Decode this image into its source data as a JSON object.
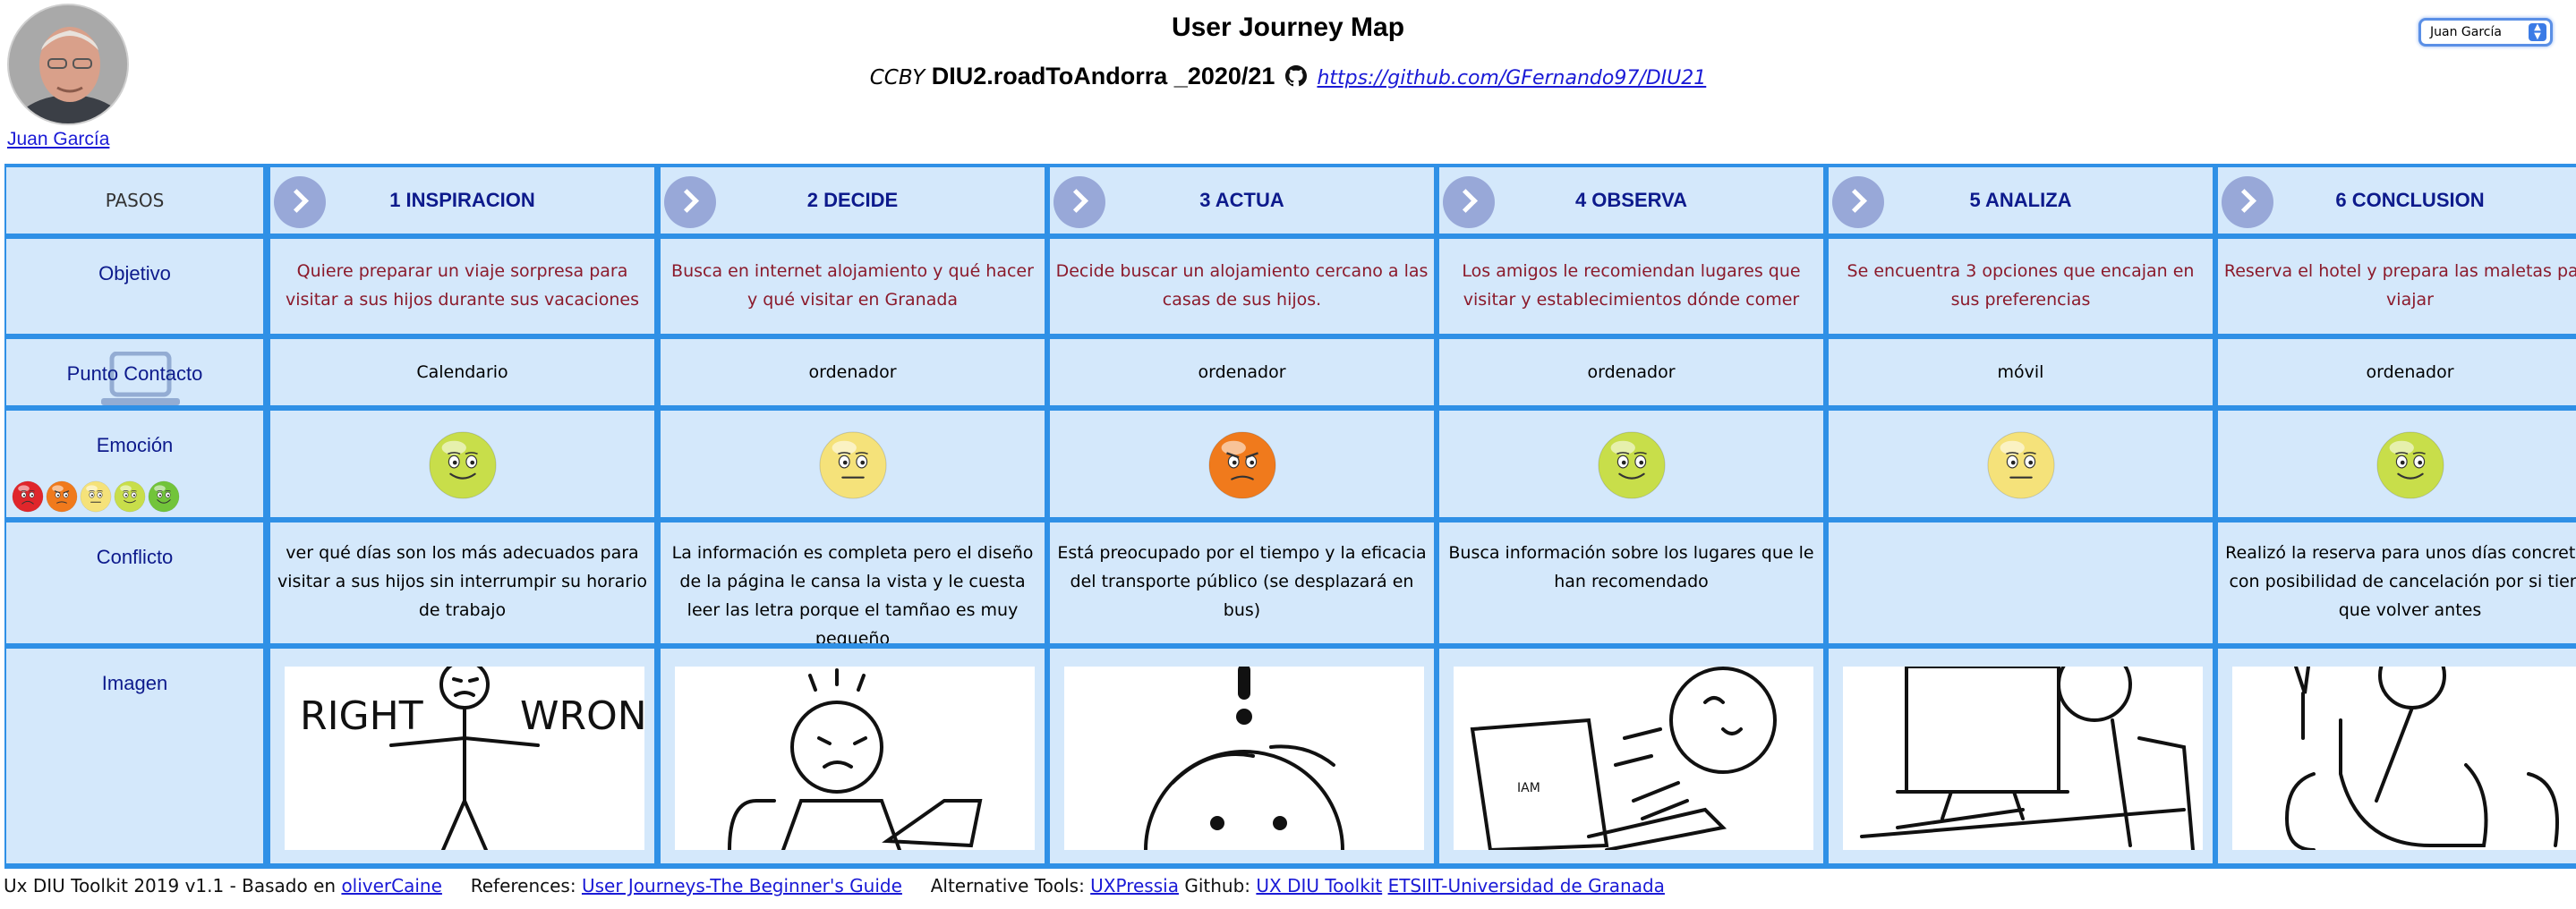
{
  "user": {
    "name": "Juan García"
  },
  "title": "User Journey Map",
  "subtitle": {
    "license": "CCBY",
    "project": "DIU2.roadToAndorra _2020/21",
    "repo_link": "https://github.com/GFernando97/DIU21"
  },
  "user_select": {
    "value": "Juan García"
  },
  "table": {
    "row_labels": {
      "pasos": "PASOS",
      "objetivo": "Objetivo",
      "contacto": "Punto Contacto",
      "emocion": "Emoción",
      "conflicto": "Conflicto",
      "imagen": "Imagen"
    },
    "steps": [
      {
        "title": "1 INSPIRACION",
        "objetivo": "Quiere preparar un viaje sorpresa para visitar a sus hijos durante sus vacaciones",
        "contacto": "Calendario",
        "emotion": "happy",
        "conflicto": "ver qué días son los más adecuados para visitar a sus hijos sin interrumpir su horario de trabajo",
        "image": "right-wrong-stickman"
      },
      {
        "title": "2 DECIDE",
        "objetivo": "Busca en internet alojamiento y qué hacer y qué visitar en Granada",
        "contacto": "ordenador",
        "emotion": "neutral",
        "conflicto": "La información es completa pero el diseño de la página le cansa la vista y le cuesta leer las letra porque el tamñao es muy pequeño",
        "image": "frustrated-stickman-laptop"
      },
      {
        "title": "3 ACTUA",
        "objetivo": "Decide buscar un alojamiento cercano a las casas de sus hijos.",
        "contacto": "ordenador",
        "emotion": "angry",
        "conflicto": "Está preocupado por el tiempo y la eficacia del transporte público (se desplazará en bus)",
        "image": "worried-stickman"
      },
      {
        "title": "4 OBSERVA",
        "objetivo": "Los amigos le recomiendan lugares que visitar y establecimientos dónde comer",
        "contacto": "ordenador",
        "emotion": "happy",
        "conflicto": "Busca información sobre los lugares que le han recomendado",
        "image": "stickman-typing-laptop"
      },
      {
        "title": "5 ANALIZA",
        "objetivo": "Se encuentra 3 opciones que encajan en sus preferencias",
        "contacto": "móvil",
        "emotion": "neutral",
        "conflicto": "",
        "image": "stickman-desktop-computer"
      },
      {
        "title": "6 CONCLUSION",
        "objetivo": "Reserva el hotel y prepara las maletas para viajar",
        "contacto": "ordenador",
        "emotion": "happy",
        "conflicto": "Realizó la reserva para unos días concretos con posibilidad de cancelación por si tiene que volver antes",
        "image": "relaxed-stickman-armchair"
      }
    ]
  },
  "emotion_colors": {
    "very_sad": "#e0262b",
    "angry": "#f07a1c",
    "neutral": "#f5e27a",
    "happy": "#c8de4a",
    "very_happy": "#72c43a"
  },
  "footer": {
    "toolkit": "Ux DIU Toolkit 2019 v1.1 - Basado en",
    "based_on_link": "oliverCaine",
    "references_label": "References:",
    "references_link": "User Journeys-The Beginner's Guide",
    "tools_label": "Alternative Tools:",
    "tools_link": "UXPressia",
    "github_label": "Github:",
    "github_link": "UX DIU Toolkit",
    "etsiit_link": "ETSIIT-Universidad de Granada"
  }
}
